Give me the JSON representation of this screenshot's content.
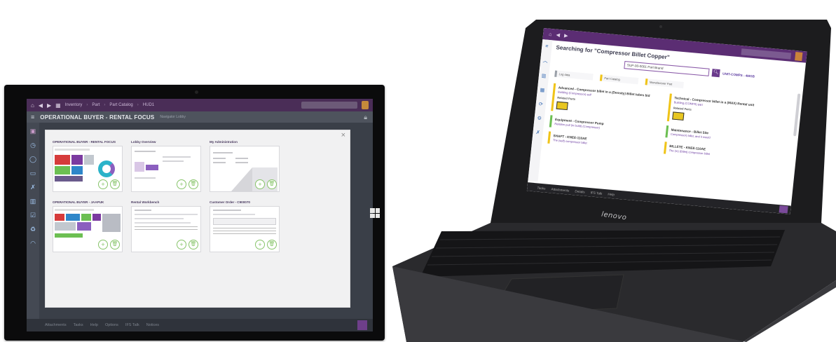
{
  "tablet": {
    "breadcrumbs": [
      "Inventory",
      "Part",
      "Part Catalog",
      "HUD1"
    ],
    "page_title": "OPERATIONAL BUYER - RENTAL FOCUS",
    "page_subtitle": "Navigator Lobby",
    "dialog": {
      "close_glyph": "×",
      "tiles": [
        {
          "title": "OPERATIONAL BUYER - RENTAL FOCUS"
        },
        {
          "title": "Lobby Overview"
        },
        {
          "title": "My Administration"
        },
        {
          "title": "OPERATIONAL BUYER - JAAPUK"
        },
        {
          "title": "Rental Workbench"
        },
        {
          "title": "Customer Order - C900070"
        }
      ]
    },
    "bottom_tabs": [
      "Attachments",
      "Tasks",
      "Help",
      "Options",
      "IFS Talk",
      "Notices"
    ],
    "colors": {
      "accent_purple": "#4a2d57",
      "add_green": "#87c46a"
    }
  },
  "laptop": {
    "heading": "Searching for \"Compressor Billet Copper\"",
    "search_value": "SUP-00-0001 Part Brand",
    "links": [
      "UNIT-COMPS - 4MGB"
    ],
    "filters": [
      "Log data",
      "Part Catalog",
      "Manufacturer Part"
    ],
    "cards_left": [
      {
        "title": "Advanced - Compressor billet in a (Density) Billet tubes bid",
        "line": "Building (Compressor) self",
        "sub": "Related Parts",
        "has_image": true
      },
      {
        "title": "Equipment - Compressor Pump",
        "line": "Relation pull (in build) (Compressor)",
        "sub": "",
        "has_image": false
      },
      {
        "title": "SHAFT - KNEE-110AE",
        "line": "The (self) compressor billet",
        "sub": "",
        "has_image": false
      }
    ],
    "cards_right": [
      {
        "title": "Technical - Compressor billet in a (MAX) Rental unit",
        "line": "Building (COMPS) part",
        "sub": "Related Parts",
        "has_image": true
      },
      {
        "title": "Maintenance - Billet Site",
        "line": "Compressor) billet, and it would",
        "sub": "",
        "has_image": false
      },
      {
        "title": "BILLETE - KNEE-110AE",
        "line": "The (m) (Billet) compressor billet",
        "sub": "",
        "has_image": false
      }
    ],
    "bottom_tabs": [
      "Tasks",
      "Attachments",
      "Details",
      "IFS Talk",
      "Help"
    ],
    "brand": "lenovo",
    "colors": {
      "accent_purple": "#5b2d73",
      "highlight_yellow": "#f0c419"
    }
  }
}
